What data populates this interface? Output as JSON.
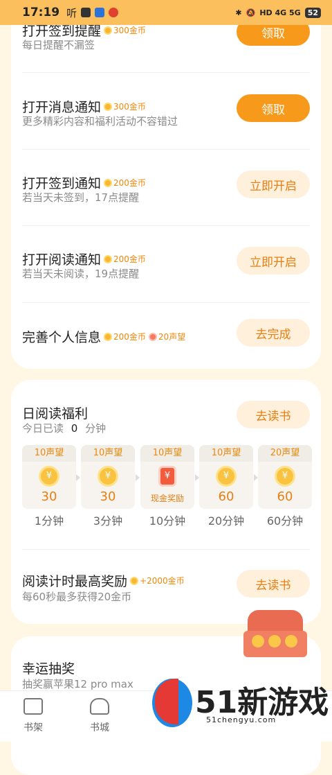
{
  "status_bar": {
    "time": "17:19",
    "carrier_glyph": "听",
    "right_text": "HD 4G 5G",
    "battery": "52"
  },
  "tasks": [
    {
      "title": "打开签到提醒",
      "reward": "300金币",
      "desc": "每日提醒不漏签",
      "button": "领取"
    },
    {
      "title": "打开消息通知",
      "reward": "300金币",
      "desc": "更多精彩内容和福利活动不容错过",
      "button": "领取"
    },
    {
      "title": "打开签到通知",
      "reward": "200金币",
      "desc": "若当天未签到，17点提醒",
      "button": "立即开启"
    },
    {
      "title": "打开阅读通知",
      "reward": "200金币",
      "desc": "若当天未阅读，19点提醒",
      "button": "立即开启"
    },
    {
      "title": "完善个人信息",
      "reward": "200金币",
      "reward2": "20声望",
      "button": "去完成"
    }
  ],
  "reading": {
    "title": "日阅读福利",
    "today_prefix": "今日已读",
    "today_value": "0",
    "today_suffix": "分钟",
    "button": "去读书",
    "days": [
      {
        "top": "10声望",
        "value": "30",
        "label": "1分钟",
        "icon": "coin-icon"
      },
      {
        "top": "10声望",
        "value": "30",
        "label": "3分钟",
        "icon": "coin-icon"
      },
      {
        "top": "10声望",
        "value": "现金奖励",
        "label": "10分钟",
        "icon": "red-envelope-icon"
      },
      {
        "top": "10声望",
        "value": "60",
        "label": "20分钟",
        "icon": "coin-icon"
      },
      {
        "top": "20声望",
        "value": "60",
        "label": "60分钟",
        "icon": "coin-icon"
      }
    ],
    "coin_symbol": "¥"
  },
  "timer_task": {
    "title": "阅读计时最高奖励",
    "reward": "+2000金币",
    "desc": "每60秒最多获得20金币",
    "button": "去读书"
  },
  "lottery": {
    "title": "幸运抽奖",
    "desc": "抽奖赢苹果12 pro max"
  },
  "bottom_nav": {
    "tab1": "书架",
    "tab2": "书城"
  },
  "watermark": {
    "big": "51新游戏",
    "small": "51chengyu.com"
  }
}
